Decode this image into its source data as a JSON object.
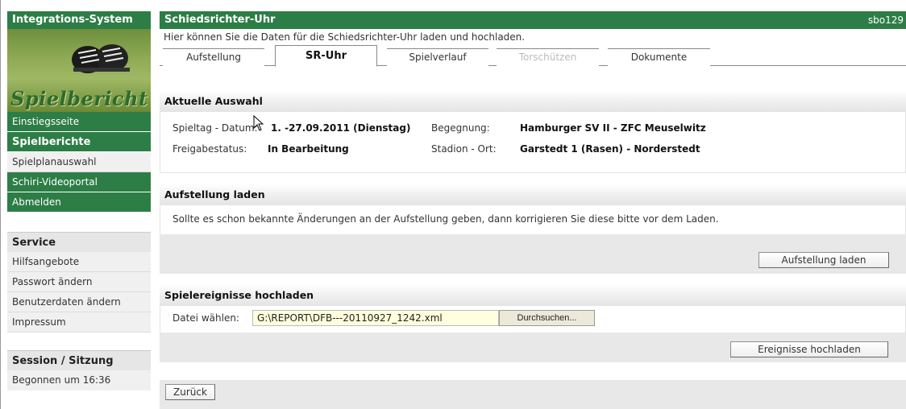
{
  "sidebar": {
    "header": "Integrations-System",
    "logo_text": "Spielbericht",
    "nav": [
      {
        "label": "Einstiegsseite"
      },
      {
        "label": "Spielberichte"
      },
      {
        "label": "Spielplanauswahl"
      },
      {
        "label": "Schiri-Videoportal"
      },
      {
        "label": "Abmelden"
      }
    ],
    "service": {
      "title": "Service",
      "items": [
        {
          "label": "Hilfsangebote"
        },
        {
          "label": "Passwort ändern"
        },
        {
          "label": "Benutzerdaten ändern"
        },
        {
          "label": "Impressum"
        }
      ]
    },
    "session": {
      "title": "Session / Sitzung",
      "started": "Begonnen um 16:36"
    }
  },
  "main": {
    "title": "Schiedsrichter-Uhr",
    "user": "sbo129",
    "intro": "Hier können Sie die Daten für die Schiedsrichter-Uhr laden und hochladen.",
    "tabs": [
      {
        "label": "Aufstellung",
        "state": "normal"
      },
      {
        "label": "SR-Uhr",
        "state": "active"
      },
      {
        "label": "Spielverlauf",
        "state": "normal"
      },
      {
        "label": "Torschützen",
        "state": "disabled"
      },
      {
        "label": "Dokumente",
        "state": "normal"
      }
    ],
    "selection": {
      "title": "Aktuelle Auswahl",
      "matchday_label": "Spieltag - Datum:",
      "matchday_value": "1. -27.09.2011 (Dienstag)",
      "fixture_label": "Begegnung:",
      "fixture_value": "Hamburger SV II - ZFC Meuselwitz",
      "status_label": "Freigabestatus:",
      "status_value": "In Bearbeitung",
      "stadium_label": "Stadion - Ort:",
      "stadium_value": "Garstedt 1 (Rasen) - Norderstedt"
    },
    "lineup": {
      "title": "Aufstellung laden",
      "text": "Sollte es schon bekannte Änderungen an der Aufstellung geben, dann korrigieren Sie diese bitte vor dem Laden.",
      "button": "Aufstellung laden"
    },
    "upload": {
      "title": "Spielereignisse hochladen",
      "file_label": "Datei wählen:",
      "file_value": "G:\\REPORT\\DFB---20110927_1242.xml",
      "browse_button": "Durchsuchen...",
      "button": "Ereignisse hochladen"
    },
    "back_button": "Zurück"
  }
}
